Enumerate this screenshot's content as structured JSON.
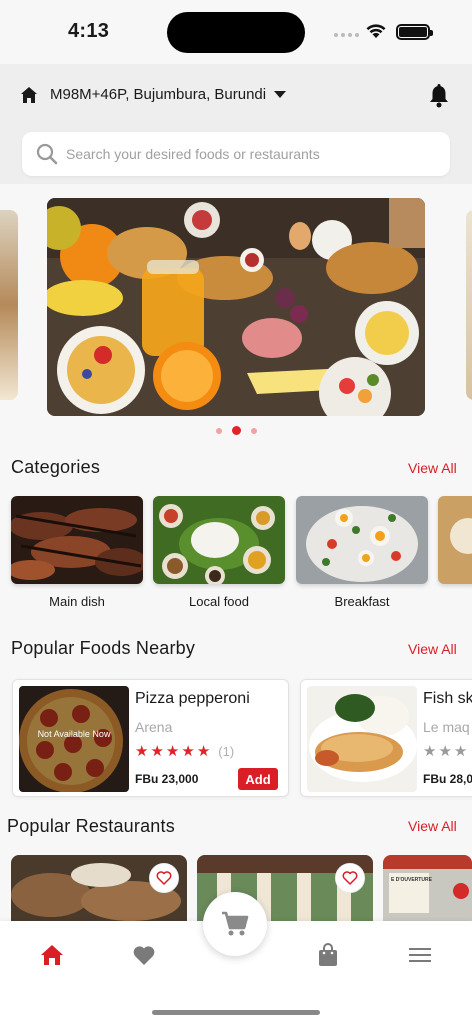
{
  "status": {
    "time": "4:13"
  },
  "header": {
    "location": "M98M+46P, Bujumbura, Burundi",
    "search_placeholder": "Search your desired foods or restaurants"
  },
  "carousel": {
    "slide_count": 3,
    "active_index": 1
  },
  "categories": {
    "title": "Categories",
    "view_all": "View All",
    "items": [
      {
        "label": "Main dish"
      },
      {
        "label": "Local food"
      },
      {
        "label": "Breakfast"
      }
    ]
  },
  "popular_foods": {
    "title": "Popular Foods Nearby",
    "view_all": "View All",
    "items": [
      {
        "name": "Pizza pepperoni",
        "restaurant": "Arena",
        "rating": 5,
        "rating_count": "(1)",
        "price": "FBu 23,000",
        "add_label": "Add",
        "availability": "Not Available Now"
      },
      {
        "name": "Fish sk",
        "restaurant": "Le maq",
        "rating": 3,
        "price": "FBu 28,00"
      }
    ]
  },
  "popular_restaurants": {
    "title": "Popular Restaurants",
    "view_all": "View All",
    "sign_text": "E D'OUVERTURE"
  },
  "colors": {
    "accent": "#d91e26",
    "background": "#f7f7f7"
  },
  "bottom_nav": [
    "home-icon",
    "heart-icon",
    "cart-icon",
    "bag-icon",
    "menu-icon"
  ]
}
